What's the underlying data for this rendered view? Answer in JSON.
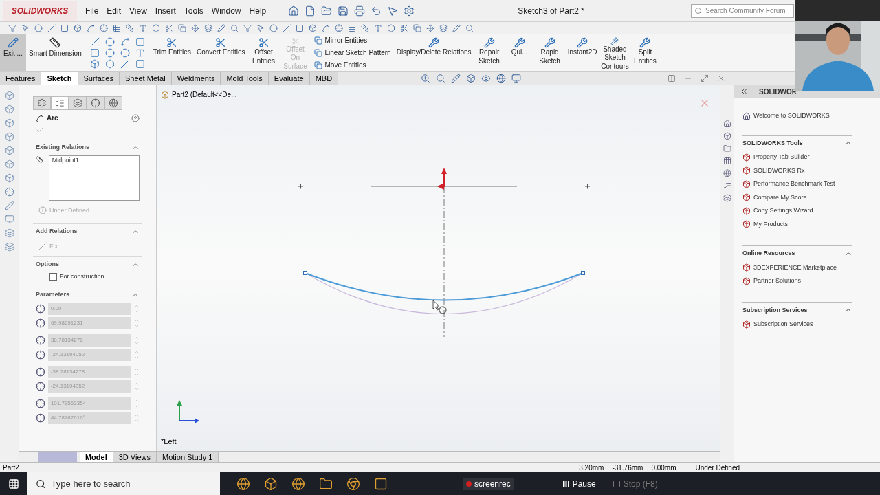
{
  "app": {
    "logo": "SOLIDWORKS",
    "menu": [
      "File",
      "Edit",
      "View",
      "Insert",
      "Tools",
      "Window",
      "Help"
    ],
    "title": "Sketch3 of Part2 *",
    "search": {
      "placeholder": "Search Community Forum"
    }
  },
  "ribbon": {
    "exit": {
      "label": "Exit ...",
      "selected": true
    },
    "smart_dimension": "Smart Dimension",
    "buttons": [
      {
        "label": "Trim Entities",
        "kind": "wide",
        "disabled": false
      },
      {
        "label": "Convert Entities",
        "kind": "wide",
        "disabled": false
      },
      {
        "label": "Offset Entities",
        "kind": "narrow",
        "disabled": false
      },
      {
        "label": "Offset On Surface",
        "kind": "narrow",
        "disabled": true
      }
    ],
    "stack": [
      "Mirror Entities",
      "Linear Sketch Pattern",
      "Move Entities"
    ],
    "more": [
      {
        "label": "Display/Delete Relations",
        "kind": "wide"
      },
      {
        "label": "Repair Sketch",
        "kind": "narrow"
      },
      {
        "label": "Qui...",
        "kind": "narrow"
      },
      {
        "label": "Rapid Sketch",
        "kind": "narrow"
      },
      {
        "label": "Instant2D",
        "kind": "wide"
      },
      {
        "label": "Shaded Sketch Contours",
        "kind": "narrow"
      },
      {
        "label": "Split Entities",
        "kind": "narrow"
      }
    ]
  },
  "tabs": [
    {
      "label": "Features",
      "selected": false
    },
    {
      "label": "Sketch",
      "selected": true
    },
    {
      "label": "Surfaces",
      "selected": false
    },
    {
      "label": "Sheet Metal",
      "selected": false
    },
    {
      "label": "Weldments",
      "selected": false
    },
    {
      "label": "Mold Tools",
      "selected": false
    },
    {
      "label": "Evaluate",
      "selected": false
    },
    {
      "label": "MBD",
      "selected": false
    }
  ],
  "feature_tree": {
    "label": "Part2  (Default<<De..."
  },
  "property_manager": {
    "title": "Arc",
    "existing_relations": {
      "title": "Existing Relations",
      "items": [
        "Midpoint1"
      ],
      "status": "Under Defined"
    },
    "add_relations": {
      "title": "Add Relations",
      "items": [
        {
          "label": "Fix",
          "disabled": true
        }
      ]
    },
    "options": {
      "title": "Options",
      "for_construction": {
        "label": "For construction",
        "checked": false
      }
    },
    "parameters": {
      "title": "Parameters",
      "fields": [
        "0.00",
        "69.98691231",
        "38.78134278",
        "-24.13194052",
        "-38.78134278",
        "-24.13194052",
        "101.79563354",
        "44.78787616°"
      ]
    }
  },
  "view_label": "*Left",
  "bottom_tabs": [
    {
      "label": "Model",
      "selected": true
    },
    {
      "label": "3D Views",
      "selected": false
    },
    {
      "label": "Motion Study 1",
      "selected": false
    }
  ],
  "status_bar": {
    "document": "Part2",
    "coords": [
      "3.20mm",
      "-31.76mm",
      "0.00mm"
    ],
    "state": "Under Defined"
  },
  "task_pane": {
    "title": "SOLIDWOR",
    "welcome": "Welcome to SOLIDWORKS",
    "groups": [
      {
        "title": "SOLIDWORKS Tools",
        "expanded": true,
        "items": [
          "Property Tab Builder",
          "SOLIDWORKS Rx",
          "Performance Benchmark Test",
          "Compare My Score",
          "Copy Settings Wizard",
          "My Products"
        ]
      },
      {
        "title": "Online Resources",
        "expanded": true,
        "items": [
          "3DEXPERIENCE Marketplace",
          "Partner Solutions"
        ]
      },
      {
        "title": "Subscription Services",
        "expanded": true,
        "items": [
          "Subscription Services"
        ]
      }
    ]
  },
  "taskbar": {
    "search_placeholder": "Type here to search",
    "recorder": "screenrec",
    "controls": [
      {
        "label": "Pause",
        "disabled": false
      },
      {
        "label": "Stop (F8)",
        "disabled": true
      }
    ]
  }
}
